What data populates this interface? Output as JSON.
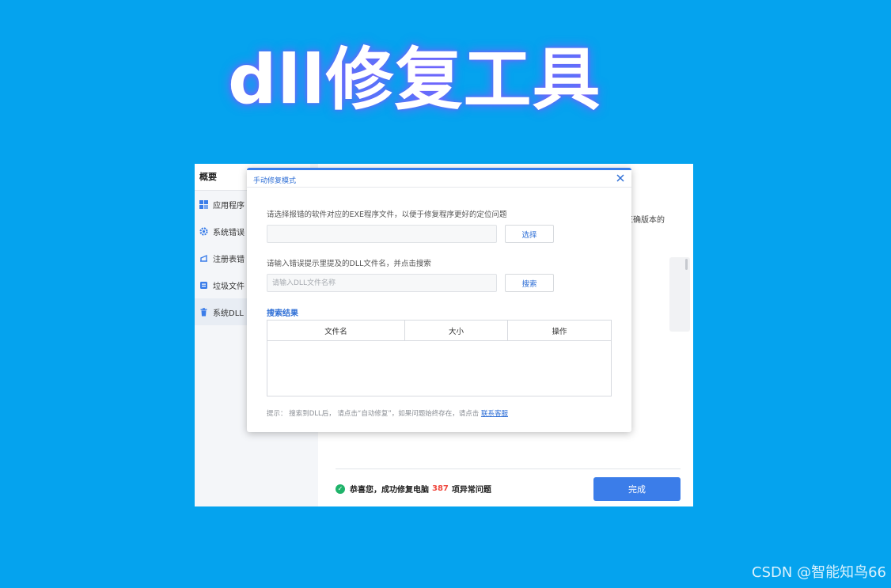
{
  "banner": {
    "title": "dll修复工具"
  },
  "sidebar": {
    "header": "概要",
    "items": [
      {
        "label": "应用程序",
        "icon": "grid-icon"
      },
      {
        "label": "系统错误",
        "icon": "gear-icon"
      },
      {
        "label": "注册表错",
        "icon": "registry-icon"
      },
      {
        "label": "垃圾文件",
        "icon": "file-box-icon"
      },
      {
        "label": "系统DLL",
        "icon": "trash-icon"
      }
    ],
    "active_index": 4
  },
  "main": {
    "side_text": "正确版本的",
    "status_prefix": "恭喜您，成功修复电脑",
    "status_count": "387",
    "status_suffix": "项异常问题",
    "done_label": "完成"
  },
  "dialog": {
    "title": "手动修复模式",
    "exe_prompt": "请选择报错的软件对应的EXE程序文件，以便于修复程序更好的定位问题",
    "exe_input_value": "",
    "select_label": "选择",
    "dll_prompt": "请输入错误提示里提及的DLL文件名，并点击搜索",
    "dll_placeholder": "请输入DLL文件名称",
    "search_label": "搜索",
    "results_title": "搜索结果",
    "columns": [
      "文件名",
      "大小",
      "操作"
    ],
    "hint_text": "提示：  搜索到DLL后，  请点击“自动修复”，如果问题始终存在，请点击",
    "hint_link": "联系客服"
  },
  "watermark": "CSDN @智能知鸟66",
  "colors": {
    "background": "#05a3ee",
    "accent": "#3b7de9",
    "success": "#1fb36a",
    "count": "#f0483e"
  }
}
